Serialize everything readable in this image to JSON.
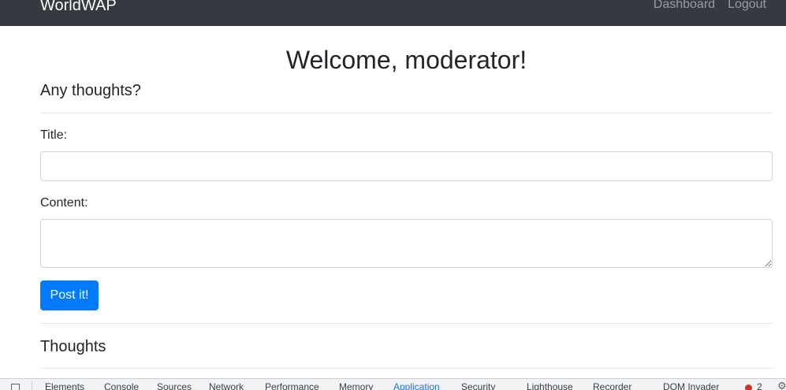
{
  "navbar": {
    "brand": "WorldWAP",
    "links": [
      "Dashboard",
      "Logout"
    ]
  },
  "main": {
    "welcome": "Welcome, moderator!",
    "form_heading": "Any thoughts?",
    "title_label": "Title:",
    "title_value": "",
    "content_label": "Content:",
    "content_value": "",
    "submit_label": "Post it!",
    "thoughts_heading": "Thoughts"
  },
  "devtools": {
    "tabs": [
      "Elements",
      "Console",
      "Sources",
      "Network",
      "Performance",
      "Memory",
      "Application",
      "Security",
      "Lighthouse",
      "Recorder",
      "DOM Invader"
    ],
    "active_tab": "Application",
    "error_count": "2"
  },
  "colors": {
    "navbar_bg": "#343a40",
    "primary": "#007bff",
    "devtools_active": "#1a73e8"
  }
}
